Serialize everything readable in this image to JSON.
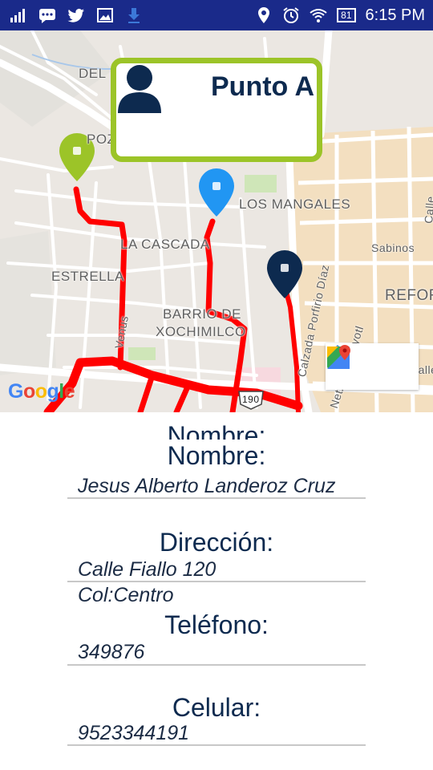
{
  "status_bar": {
    "time": "6:15 PM",
    "battery": "81",
    "icons": [
      "signal-icon",
      "chat-icon",
      "twitter-icon",
      "image-icon",
      "download-icon",
      "location-icon",
      "alarm-icon",
      "wifi-icon",
      "battery-icon"
    ]
  },
  "map": {
    "labels": {
      "del": "DEL",
      "poz": "POZ",
      "los_mangales": "LOS MANGALES",
      "la_cascada": "LA CASCADA",
      "estrella": "ESTRELLA",
      "barrio_line1": "BARRIO DE",
      "barrio_line2": "XOCHIMILCO",
      "sabinos": "Sabinos",
      "refor": "REFOR",
      "venus": "Venus",
      "calzada": "Calzada Porfirio Díaz",
      "netzahualcoyotl": "Netzahualcoyotl",
      "calle": "Calle",
      "calle_edge": "Calle",
      "route_shield": "190"
    },
    "google_logo": "Google",
    "markers": {
      "green": "#9cc428",
      "blue": "#2196f3",
      "navy": "#0d2a4f"
    },
    "route_color": "#ff0000"
  },
  "info_card": {
    "title": "Punto A",
    "border_color": "#9cc428"
  },
  "details": {
    "ghost_label": "Nombre:",
    "name_label": "Nombre:",
    "name_value": "Jesus Alberto Landeroz Cruz",
    "address_label": "Dirección:",
    "address_line1": "Calle Fiallo 120",
    "address_line2": "Col:Centro",
    "phone_label": "Teléfono:",
    "phone_value": "349876",
    "mobile_label": "Celular:",
    "mobile_value": "9523344191"
  }
}
